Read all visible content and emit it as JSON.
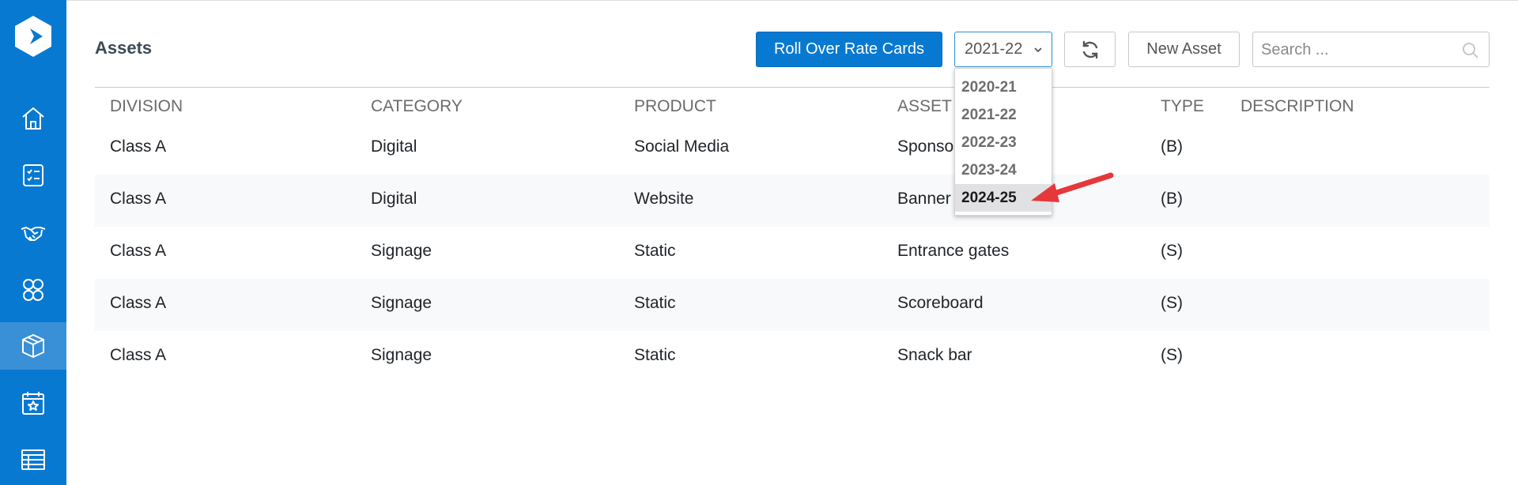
{
  "colors": {
    "sidebar": "#0779d1",
    "sidebar_active": "#3a90d6",
    "primary": "#0779d1",
    "annotation": "#e5383b"
  },
  "sidebar": {
    "logo": "app-logo",
    "items": [
      {
        "icon": "home-icon"
      },
      {
        "icon": "checklist-icon"
      },
      {
        "icon": "handshake-icon"
      },
      {
        "icon": "people-icon"
      },
      {
        "icon": "box-icon",
        "active": true
      },
      {
        "icon": "calendar-star-icon"
      },
      {
        "icon": "table-icon"
      }
    ]
  },
  "header": {
    "title": "Assets",
    "rollover_label": "Roll Over Rate Cards",
    "year_selected": "2021-22",
    "new_asset_label": "New Asset",
    "search_placeholder": "Search ..."
  },
  "table": {
    "columns": [
      "DIVISION",
      "CATEGORY",
      "PRODUCT",
      "ASSET",
      "TYPE",
      "DESCRIPTION"
    ],
    "rows": [
      [
        "Class A",
        "Digital",
        "Social Media",
        "Sponso",
        "(B)",
        ""
      ],
      [
        "Class A",
        "Digital",
        "Website",
        "Banner",
        "(B)",
        ""
      ],
      [
        "Class A",
        "Signage",
        "Static",
        "Entrance gates",
        "(S)",
        ""
      ],
      [
        "Class A",
        "Signage",
        "Static",
        "Scoreboard",
        "(S)",
        ""
      ],
      [
        "Class A",
        "Signage",
        "Static",
        "Snack bar",
        "(S)",
        ""
      ]
    ]
  },
  "year_dropdown": {
    "options": [
      "2020-21",
      "2021-22",
      "2022-23",
      "2023-24",
      "2024-25"
    ],
    "highlighted": "2024-25"
  }
}
